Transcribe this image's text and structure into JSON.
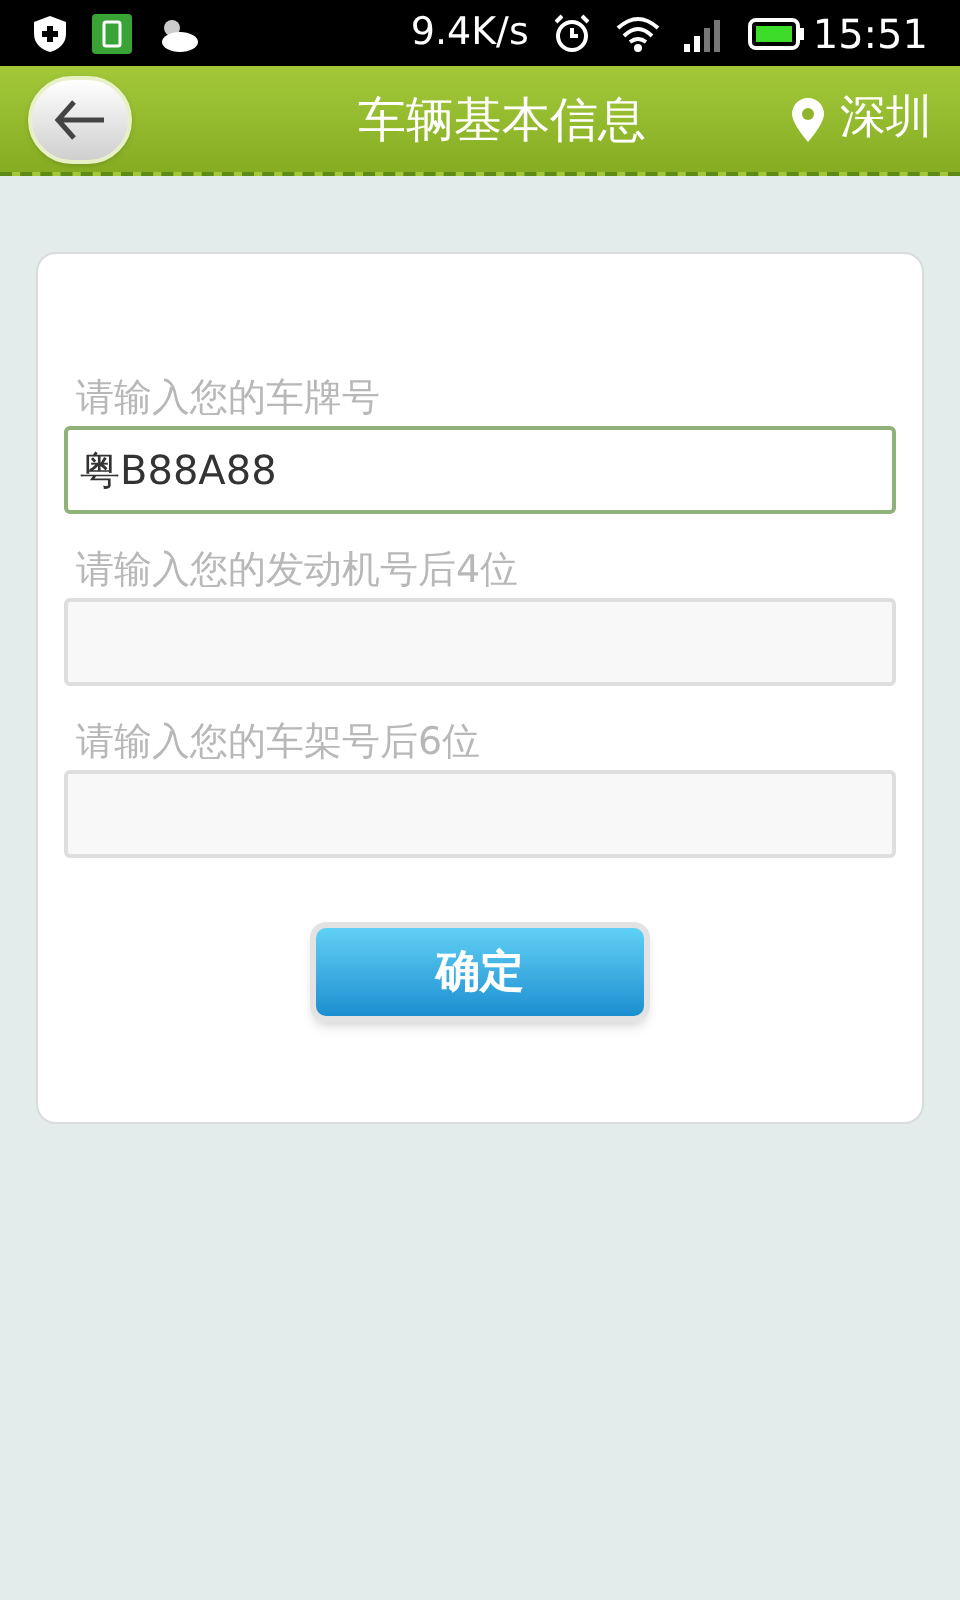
{
  "status_bar": {
    "speed": "9.4K/s",
    "time": "15:51"
  },
  "header": {
    "title": "车辆基本信息",
    "city": "深圳"
  },
  "fields": [
    {
      "label": "请输入您的车牌号",
      "value": "粤B88A88",
      "focused": true
    },
    {
      "label": "请输入您的发动机号后4位",
      "focused": false
    },
    {
      "label": "请输入您的车架号后6位",
      "focused": false
    }
  ],
  "submit_button": "确定"
}
